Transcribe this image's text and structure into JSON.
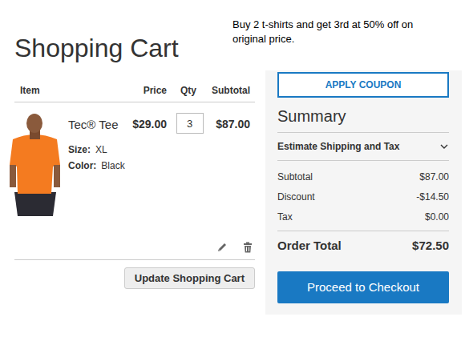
{
  "promo": {
    "text": "Buy 2 t-shirts and get 3rd at 50% off on original price."
  },
  "page": {
    "title": "Shopping Cart"
  },
  "cart": {
    "columns": [
      "Item",
      "Price",
      "Qty",
      "Subtotal"
    ],
    "items": [
      {
        "name": "Tec® Tee",
        "price": "$29.00",
        "qty": "3",
        "subtotal": "$87.00",
        "options": [
          {
            "label": "Size:",
            "value": "XL"
          },
          {
            "label": "Color:",
            "value": "Black"
          }
        ]
      }
    ],
    "update_button": "Update Shopping Cart"
  },
  "summary": {
    "coupon_button": "APPLY COUPON",
    "title": "Summary",
    "shipping": {
      "label": "Estimate Shipping and Tax",
      "expanded": false
    },
    "totals": [
      {
        "label": "Subtotal",
        "value": "$87.00"
      },
      {
        "label": "Discount",
        "value": "-$14.50"
      },
      {
        "label": "Tax",
        "value": "$0.00"
      }
    ],
    "order_total": {
      "label": "Order Total",
      "value": "$72.50"
    },
    "checkout_button": "Proceed to Checkout"
  }
}
